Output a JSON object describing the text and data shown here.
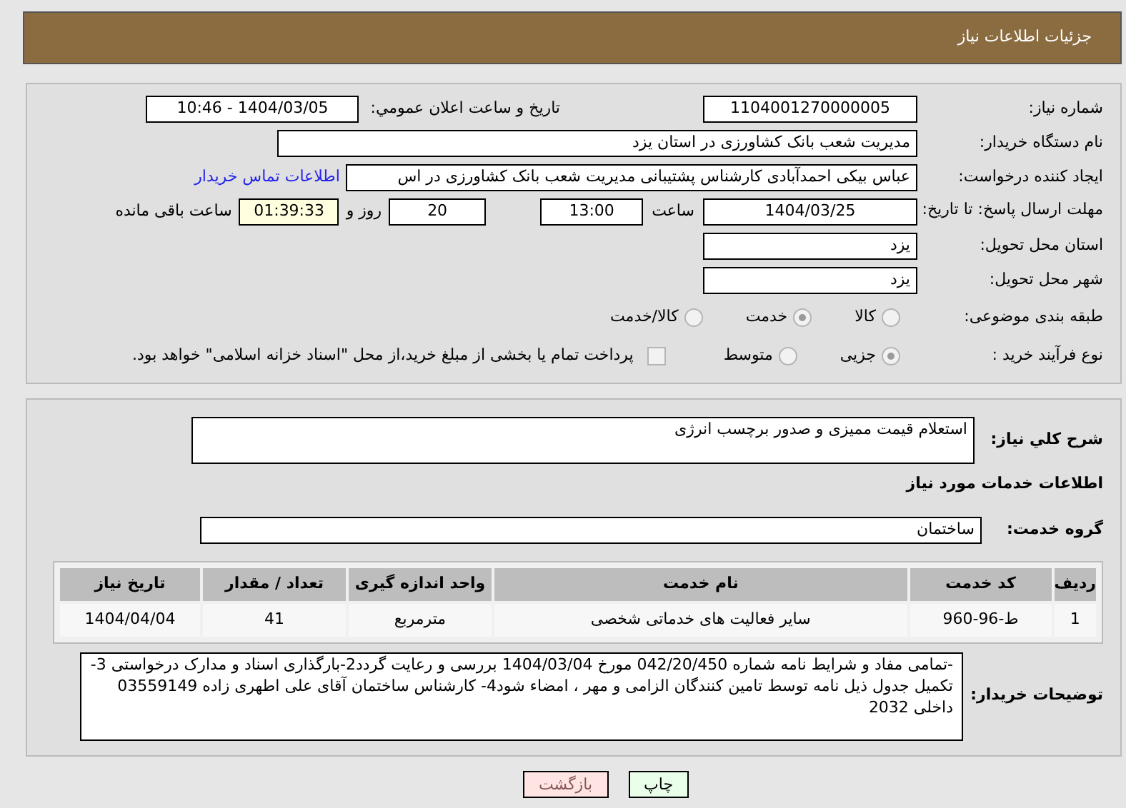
{
  "header": {
    "title": "جزئیات اطلاعات نیاز"
  },
  "fields": {
    "need_number": {
      "label": "شماره نیاز:",
      "value": "1104001270000005"
    },
    "announce": {
      "label": "تاریخ و ساعت اعلان عمومي:",
      "value": "1404/03/05 - 10:46"
    },
    "buyer": {
      "label": "نام دستگاه خریدار:",
      "value": "مدیریت شعب بانک کشاورزی در استان یزد"
    },
    "creator": {
      "label": "ایجاد کننده درخواست:",
      "value": "عباس بیکی احمدآبادی کارشناس پشتیبانی مدیریت شعب بانک کشاورزی در اس",
      "link": "اطلاعات تماس خریدار"
    },
    "deadline": {
      "label": "مهلت ارسال پاسخ: تا تاریخ:",
      "date": "1404/03/25",
      "time_label": "ساعت",
      "time": "13:00",
      "days": "20",
      "days_label": "روز و",
      "remaining": "01:39:33",
      "remaining_label": "ساعت باقی مانده"
    },
    "province": {
      "label": "استان محل تحویل:",
      "value": "یزد"
    },
    "city": {
      "label": "شهر محل تحویل:",
      "value": "یزد"
    }
  },
  "category": {
    "label": "طبقه بندی موضوعی:",
    "options": [
      {
        "label": "کالا",
        "selected": false
      },
      {
        "label": "خدمت",
        "selected": true
      },
      {
        "label": "کالا/خدمت",
        "selected": false
      }
    ]
  },
  "process": {
    "label": "نوع فرآیند خرید :",
    "options": [
      {
        "label": "جزیی",
        "selected": true
      },
      {
        "label": "متوسط",
        "selected": false
      }
    ],
    "payment": {
      "checked": false,
      "label": "پرداخت تمام یا بخشی از مبلغ خرید،از محل \"اسناد خزانه اسلامی\" خواهد بود."
    }
  },
  "description": {
    "label": "شرح کلي نیاز:",
    "value": "استعلام قیمت ممیزی و صدور برچسب انرژی"
  },
  "services_heading": "اطلاعات خدمات مورد نیاز",
  "service_group": {
    "label": "گروه خدمت:",
    "value": "ساختمان"
  },
  "table": {
    "columns": [
      "ردیف",
      "کد خدمت",
      "نام خدمت",
      "واحد اندازه گیری",
      "تعداد / مقدار",
      "تاریخ نیاز"
    ],
    "rows": [
      [
        "1",
        "ط-96-960",
        "سایر فعالیت های خدماتی شخصی",
        "مترمربع",
        "41",
        "1404/04/04"
      ]
    ]
  },
  "buyer_notes": {
    "label": "توضیحات خریدار:",
    "value": "-تمامی مفاد و شرایط نامه شماره 042/20/450 مورخ 1404/03/04 بررسی و رعایت گردد2-بارگذاری اسناد و مدارک درخواستی 3-تکمیل جدول ذیل نامه توسط تامین کنندگان الزامی و مهر ، امضاء شود4- کارشناس ساختمان آقای علی اطهری زاده 03559149 داخلی 2032"
  },
  "buttons": [
    {
      "label": "چاپ",
      "kind": "print"
    },
    {
      "label": "بازگشت",
      "kind": "back"
    }
  ]
}
